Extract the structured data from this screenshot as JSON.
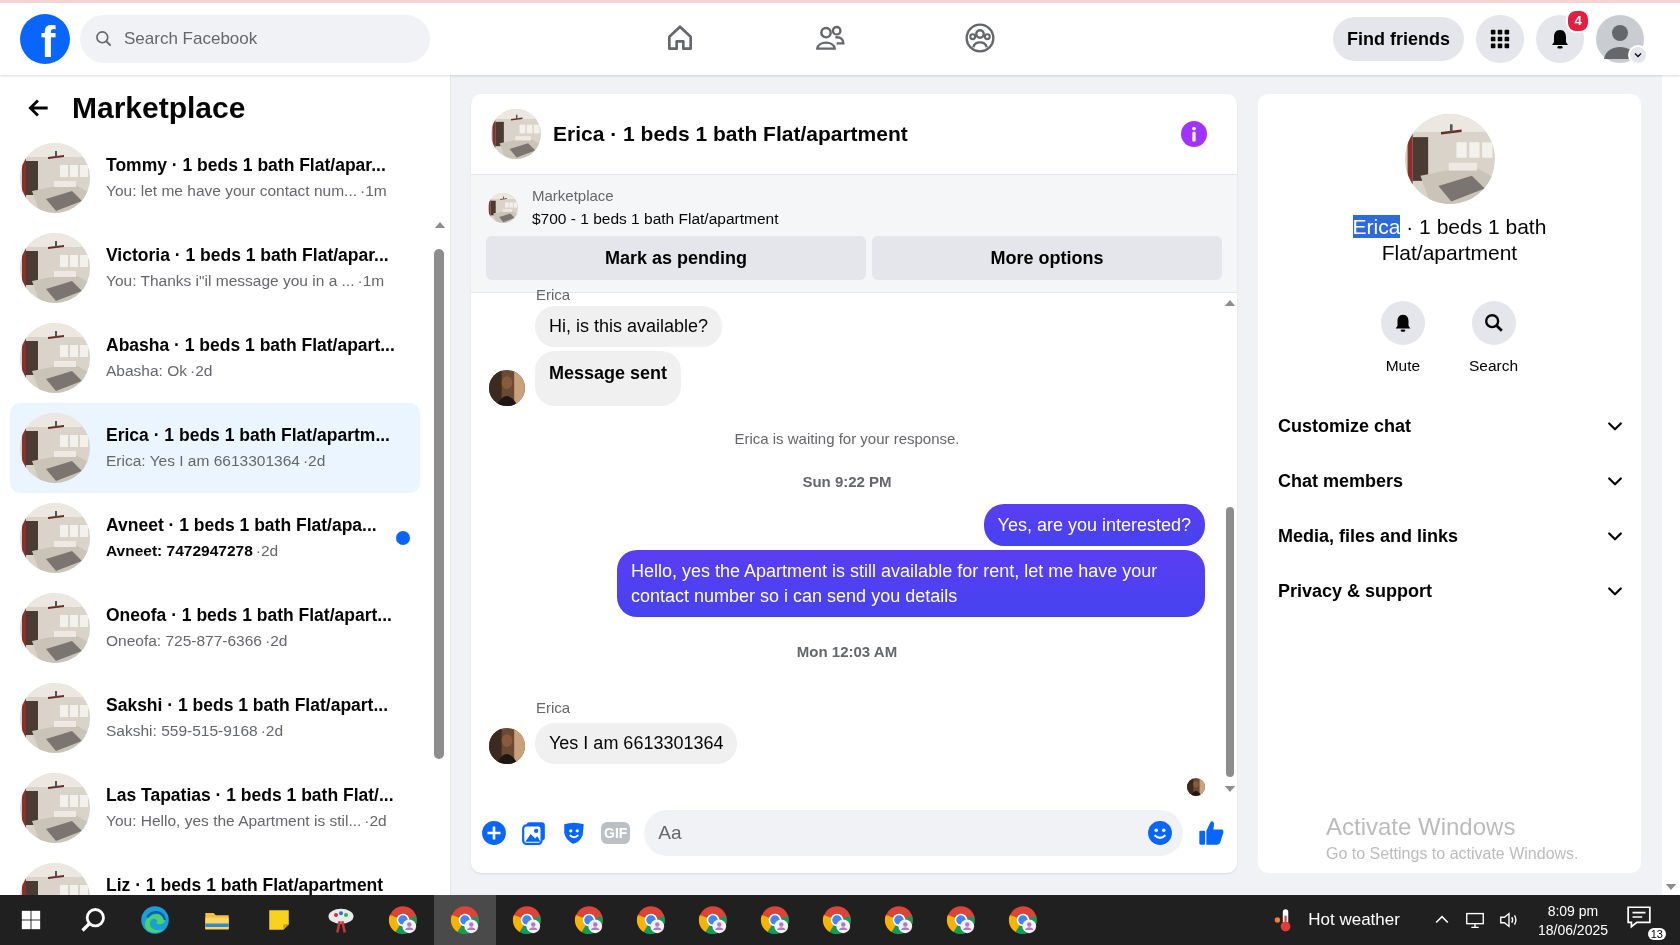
{
  "topbar": {
    "logo_letter": "f",
    "search": {
      "placeholder": "Search Facebook"
    },
    "nav": [
      {
        "kind": "home",
        "selected": false
      },
      {
        "kind": "friends",
        "selected": false
      },
      {
        "kind": "groups",
        "selected": false
      }
    ],
    "find_friends": "Find friends",
    "notification_count": "4"
  },
  "sidebar": {
    "title": "Marketplace",
    "conversations": [
      {
        "title": "Tommy · 1 beds 1 bath Flat/apar...",
        "preview": "You: let me have your contact num...",
        "time": "·1m",
        "selected": false,
        "unread": false
      },
      {
        "title": "Victoria · 1 beds 1 bath Flat/apar...",
        "preview": "You: Thanks i\"il message you in a ...",
        "time": "·1m",
        "selected": false,
        "unread": false
      },
      {
        "title": "Abasha · 1 beds 1 bath Flat/apart...",
        "preview": "Abasha: Ok",
        "time": "·2d",
        "selected": false,
        "unread": false
      },
      {
        "title": "Erica · 1 beds 1 bath Flat/apartm...",
        "preview": "Erica: Yes I am 6613301364",
        "time": "·2d",
        "selected": true,
        "unread": false
      },
      {
        "title": "Avneet · 1 beds 1 bath Flat/apa...",
        "preview": "Avneet: 7472947278",
        "time": "·2d",
        "selected": false,
        "unread": true
      },
      {
        "title": "Oneofa · 1 beds 1 bath Flat/apart...",
        "preview": "Oneofa: 725-877-6366",
        "time": "·2d",
        "selected": false,
        "unread": false
      },
      {
        "title": "Sakshi · 1 beds 1 bath Flat/apart...",
        "preview": "Sakshi: 559-515-9168",
        "time": "·2d",
        "selected": false,
        "unread": false
      },
      {
        "title": "Las Tapatias · 1 beds 1 bath Flat/...",
        "preview": "You: Hello, yes the Apartment is stil...",
        "time": "·2d",
        "selected": false,
        "unread": false
      },
      {
        "title": "Liz · 1 beds 1 bath Flat/apartment",
        "selected": false,
        "unread": false
      }
    ]
  },
  "chat": {
    "title": "Erica · 1 beds 1 bath Flat/apartment",
    "listing": {
      "source": "Marketplace",
      "summary": "$700 - 1 beds 1 bath Flat/apartment"
    },
    "actions": [
      "Mark as pending",
      "More options"
    ],
    "messages": [
      {
        "kind": "sender",
        "text": "Erica"
      },
      {
        "kind": "incoming",
        "text": "Hi, is this available?",
        "avatar": false
      },
      {
        "kind": "incoming_bold",
        "text": "Message sent",
        "avatar": true
      },
      {
        "kind": "notice",
        "text": "Erica is waiting for your response."
      },
      {
        "kind": "time",
        "text": "Sun 9:22 PM"
      },
      {
        "kind": "outgoing",
        "text": "Yes, are you interested?"
      },
      {
        "kind": "outgoing",
        "text": "Hello, yes the Apartment is still available for rent, let me have your contact number so i can send you details"
      },
      {
        "kind": "time",
        "text": "Mon 12:03 AM"
      },
      {
        "kind": "sender",
        "text": "Erica"
      },
      {
        "kind": "incoming",
        "text": "Yes I am 6613301364",
        "avatar": true
      },
      {
        "kind": "seen"
      }
    ],
    "composer": {
      "gif_label": "GIF",
      "placeholder": "Aa"
    }
  },
  "details": {
    "title_parts": [
      {
        "text": "Erica",
        "selected": true
      },
      {
        "text": " · 1 beds 1 bath Flat/apartment",
        "selected": false
      }
    ],
    "actions": [
      {
        "kind": "mute",
        "label": "Mute"
      },
      {
        "kind": "search",
        "label": "Search"
      }
    ],
    "sections": [
      {
        "label": "Customize chat",
        "expanded": false
      },
      {
        "label": "Chat members",
        "expanded": false
      },
      {
        "label": "Media, files and links",
        "expanded": false
      },
      {
        "label": "Privacy & support",
        "expanded": false
      }
    ]
  },
  "os_notice": {
    "title": "Activate Windows",
    "subtitle": "Go to Settings to activate Windows."
  },
  "taskbar": {
    "apps": [
      {
        "kind": "start",
        "active": false
      },
      {
        "kind": "search",
        "active": false
      },
      {
        "kind": "edge",
        "active": false
      },
      {
        "kind": "files",
        "active": false
      },
      {
        "kind": "notes",
        "active": false
      },
      {
        "kind": "paint",
        "active": false
      },
      {
        "kind": "browser",
        "active": false
      },
      {
        "kind": "browser",
        "active": true
      },
      {
        "kind": "browser",
        "active": false
      },
      {
        "kind": "browser",
        "active": false
      },
      {
        "kind": "browser",
        "active": false
      },
      {
        "kind": "browser",
        "active": false
      },
      {
        "kind": "browser",
        "active": false
      },
      {
        "kind": "browser",
        "active": false
      },
      {
        "kind": "browser",
        "active": false
      },
      {
        "kind": "browser",
        "active": false
      },
      {
        "kind": "browser",
        "active": false
      }
    ],
    "weather": "Hot weather",
    "time": "8:09 pm",
    "date": "18/06/2025",
    "notification_count": "13"
  }
}
